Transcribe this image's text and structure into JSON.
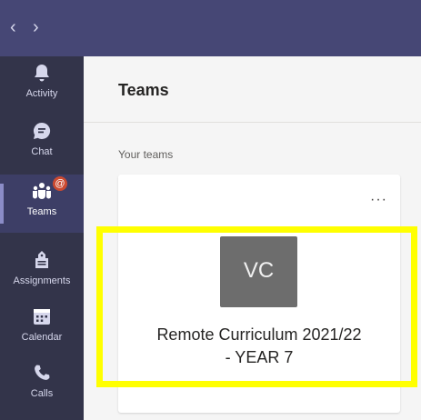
{
  "nav": {
    "back": "‹",
    "forward": "›"
  },
  "rail": [
    {
      "label": "Activity",
      "icon": "bell-icon"
    },
    {
      "label": "Chat",
      "icon": "chat-icon"
    },
    {
      "label": "Teams",
      "icon": "teams-icon",
      "active": true,
      "badge": "@"
    },
    {
      "label": "Assignments",
      "icon": "assignments-icon"
    },
    {
      "label": "Calendar",
      "icon": "calendar-icon"
    },
    {
      "label": "Calls",
      "icon": "phone-icon"
    }
  ],
  "header": {
    "title": "Teams"
  },
  "section": {
    "label": "Your teams"
  },
  "team_card": {
    "more": "···",
    "abbr": "VC",
    "name_line1": "Remote Curriculum 2021/22",
    "name_line2": "- YEAR 7"
  },
  "colors": {
    "titlebar": "#464775",
    "rail": "#33344a",
    "highlight": "#ffff00",
    "tile": "#6d6d6d",
    "badge": "#cc4a31"
  }
}
